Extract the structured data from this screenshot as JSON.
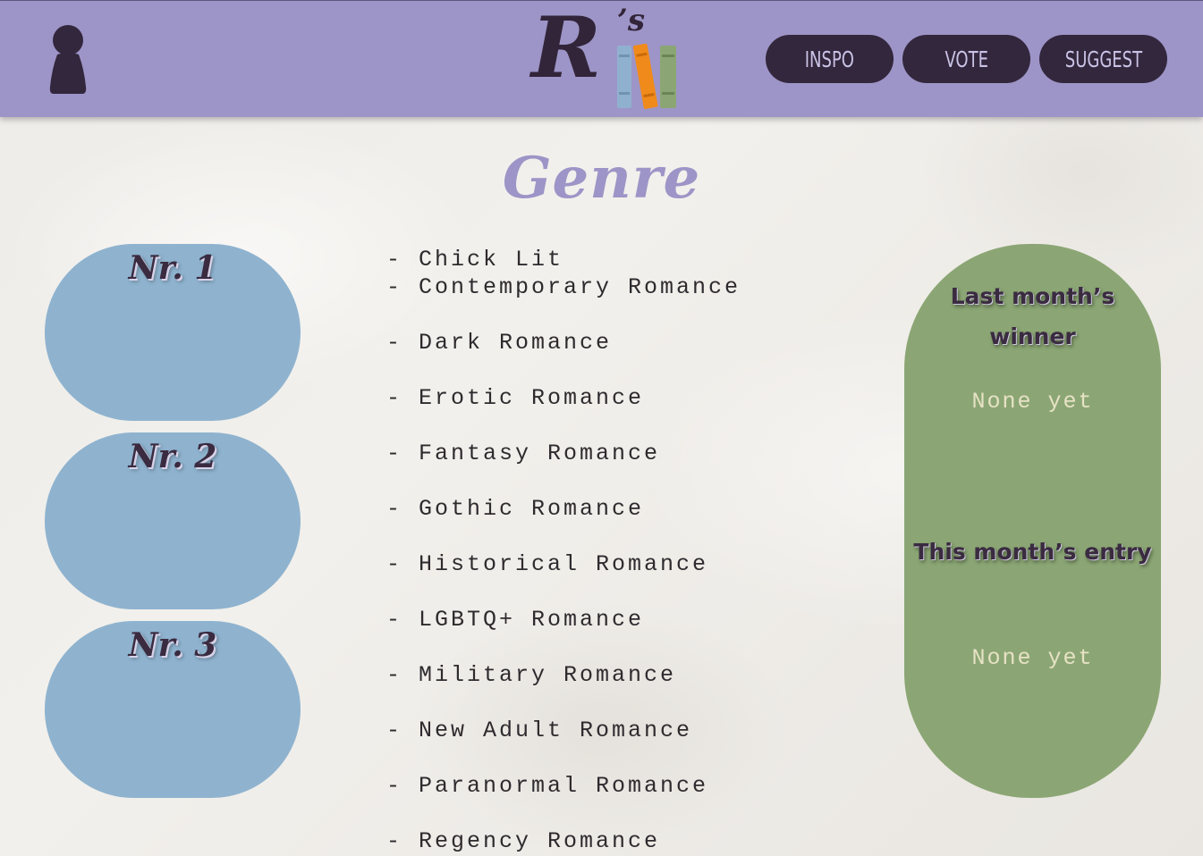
{
  "header": {
    "logo": {
      "letter": "R",
      "suffix": "’s"
    },
    "nav": [
      {
        "label": "INSPO"
      },
      {
        "label": "VOTE"
      },
      {
        "label": "SUGGEST"
      }
    ]
  },
  "colors": {
    "header_bg": "#9d95c7",
    "nav_bg": "#33273d",
    "nav_text": "#c9c3e6",
    "rank_bg": "#8fb3cf",
    "panel_bg": "#8ba674",
    "title": "#9d95c7"
  },
  "main": {
    "title": "Genre",
    "ranks": [
      {
        "label": "Nr. 1"
      },
      {
        "label": "Nr. 2"
      },
      {
        "label": "Nr. 3"
      }
    ],
    "genres": [
      "- Chick Lit",
      "- Contemporary Romance",
      "- Dark Romance",
      "- Erotic Romance",
      "- Fantasy Romance",
      "- Gothic Romance",
      "- Historical Romance",
      "- LGBTQ+ Romance",
      "- Military Romance",
      "- New Adult Romance",
      "- Paranormal Romance",
      "- Regency Romance"
    ],
    "winner_panel": {
      "last_heading": "Last month’s winner",
      "last_value": "None yet",
      "this_heading": "This month’s entry",
      "this_value": "None yet"
    }
  }
}
